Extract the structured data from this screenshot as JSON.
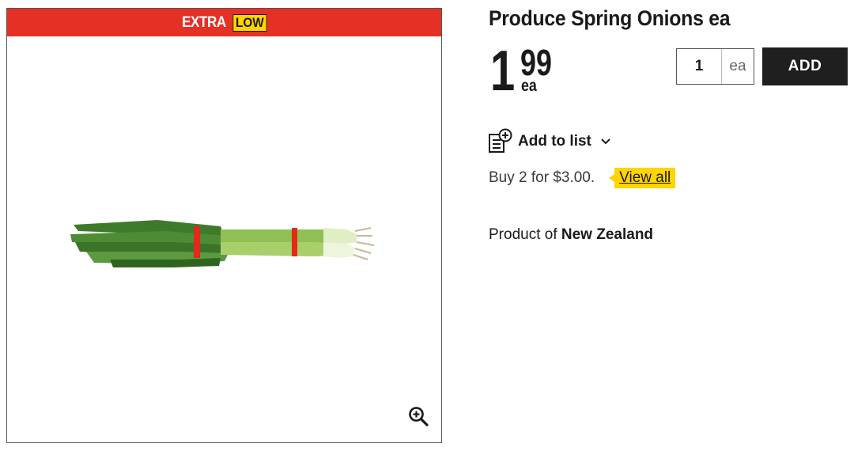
{
  "promo": {
    "word": "EXTRA",
    "tag": "LOW",
    "banner_color": "#e53125",
    "tag_color": "#ffd400"
  },
  "product": {
    "title": "Produce Spring Onions ea",
    "image_icon": "spring-onions-image"
  },
  "price": {
    "dollars": "1",
    "cents": "99",
    "unit": "ea"
  },
  "quantity": {
    "value": "1",
    "unit": "ea"
  },
  "actions": {
    "add_label": "ADD",
    "add_to_list_label": "Add to list",
    "add_to_list_icon": "add-to-list-icon",
    "zoom_icon": "zoom-in-icon"
  },
  "offer": {
    "text": "Buy 2 for $3.00.",
    "link_label": "View all",
    "link_color": "#ffd400"
  },
  "origin": {
    "prefix": "Product of",
    "country": "New Zealand"
  },
  "colors": {
    "add_button": "#1f1f1f",
    "text": "#1a1a1a"
  }
}
